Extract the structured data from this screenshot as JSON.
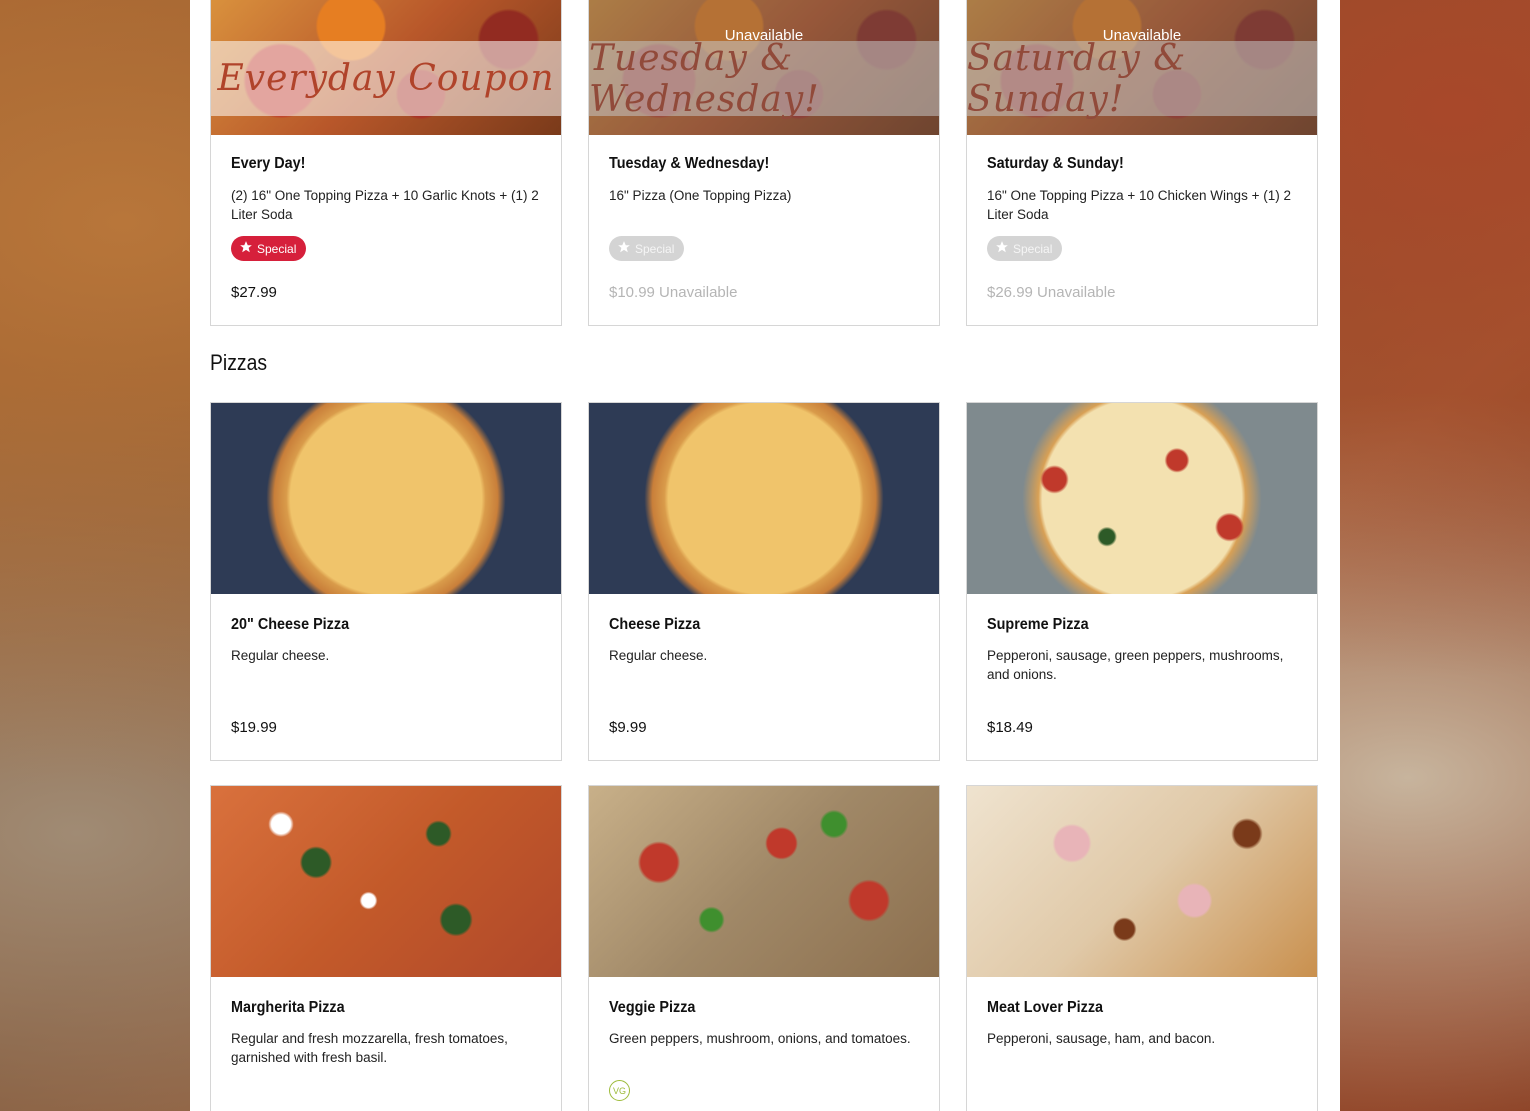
{
  "specials": [
    {
      "banner": "Everyday Coupon",
      "title": "Every Day!",
      "description": "(2) 16\" One Topping Pizza + 10 Garlic Knots + (1) 2 Liter Soda",
      "badge": "Special",
      "price": "$27.99",
      "available": true
    },
    {
      "banner": "Tuesday & Wednesday!",
      "overlay_text": "Unavailable",
      "title": "Tuesday & Wednesday!",
      "description": "16\" Pizza (One Topping Pizza)",
      "badge": "Special",
      "price": "$10.99 Unavailable",
      "available": false
    },
    {
      "banner": "Saturday & Sunday!",
      "overlay_text": "Unavailable",
      "title": "Saturday & Sunday!",
      "description": "16\" One Topping Pizza + 10 Chicken Wings + (1) 2 Liter Soda",
      "badge": "Special",
      "price": "$26.99 Unavailable",
      "available": false
    }
  ],
  "pizzas_section": {
    "title": "Pizzas",
    "items": [
      {
        "title": "20\" Cheese Pizza",
        "description": "Regular cheese.",
        "price": "$19.99"
      },
      {
        "title": "Cheese Pizza",
        "description": "Regular cheese.",
        "price": "$9.99"
      },
      {
        "title": "Supreme Pizza",
        "description": "Pepperoni, sausage, green peppers, mushrooms, and onions.",
        "price": "$18.49"
      },
      {
        "title": "Margherita Pizza",
        "description": "Regular and fresh mozzarella, fresh tomatoes, garnished with fresh basil."
      },
      {
        "title": "Veggie Pizza",
        "description": "Green peppers, mushroom, onions, and tomatoes.",
        "diet_tag": "VG"
      },
      {
        "title": "Meat Lover Pizza",
        "description": "Pepperoni, sausage, ham, and bacon."
      }
    ]
  },
  "icons": {
    "badge_icon": "star-icon",
    "veggie_icon": "vegan-icon"
  },
  "colors": {
    "accent": "#d6203b",
    "veggie": "#9dbb3a"
  }
}
